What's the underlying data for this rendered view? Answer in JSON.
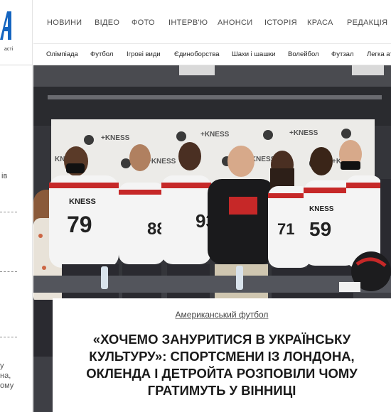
{
  "sidebar": {
    "logo_tagline": "асті",
    "fragments": [
      "ів",
      "у",
      "на,",
      "ому"
    ]
  },
  "topnav": {
    "items": [
      "НОВИНИ",
      "ВІДЕО",
      "ФОТО",
      "ІНТЕРВ'Ю",
      "АНОНСИ",
      "ІСТОРІЯ",
      "КРАСА",
      "РЕДАКЦІЯ"
    ]
  },
  "subnav": {
    "items": [
      "Олімпіада",
      "Футбол",
      "Ігрові види",
      "Єдиноборства",
      "Шахи і шашки",
      "Волейбол",
      "Футзал",
      "Легка атл"
    ]
  },
  "hero": {
    "banner_brand": "KNESS",
    "jersey_numbers": [
      "79",
      "88",
      "93",
      "59",
      "71"
    ]
  },
  "article": {
    "category": "Американський футбол",
    "headline": "«Хочемо зануритися в українську культуру»: спортсмени із Лондона, Окленда і Детройта розповіли чому гратимуть у Вінниці"
  },
  "colors": {
    "brand_blue": "#1565c0",
    "jersey_red": "#c62828",
    "text_dark": "#1a1a1a"
  }
}
